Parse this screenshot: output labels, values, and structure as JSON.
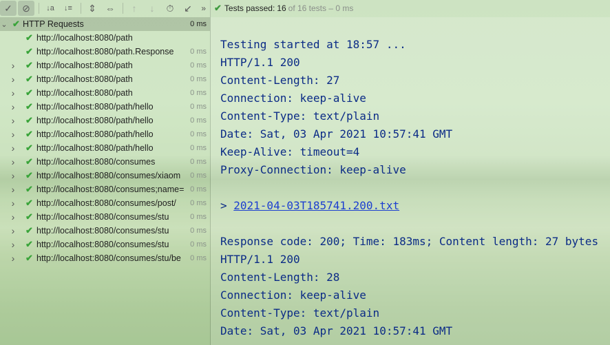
{
  "toolbar": {
    "buttons": [
      {
        "name": "show-passed-icon",
        "glyph": "✓"
      },
      {
        "name": "show-ignored-icon",
        "glyph": "⊘"
      },
      {
        "name": "sort-alphabetically-icon",
        "glyph": "↓a"
      },
      {
        "name": "sort-by-duration-icon",
        "glyph": "↓≡"
      },
      {
        "name": "expand-all-icon",
        "glyph": "⇕"
      },
      {
        "name": "collapse-all-icon",
        "glyph": "⇔"
      },
      {
        "name": "previous-failed-icon",
        "glyph": "↑"
      },
      {
        "name": "next-failed-icon",
        "glyph": "↓"
      },
      {
        "name": "test-history-icon",
        "glyph": "⏱"
      },
      {
        "name": "export-results-icon",
        "glyph": "↙"
      }
    ],
    "more_glyph": "»"
  },
  "status": {
    "passed_label": "Tests passed:",
    "count": "16",
    "rest": "of 16 tests – 0 ms"
  },
  "tree": {
    "root": {
      "label": "HTTP Requests",
      "time": "0 ms"
    },
    "items": [
      {
        "label": "http://localhost:8080/path",
        "time": "",
        "expandable": false
      },
      {
        "label": "http://localhost:8080/path.Response",
        "time": "0 ms",
        "expandable": false
      },
      {
        "label": "http://localhost:8080/path",
        "time": "0 ms",
        "expandable": true
      },
      {
        "label": "http://localhost:8080/path",
        "time": "0 ms",
        "expandable": true
      },
      {
        "label": "http://localhost:8080/path",
        "time": "0 ms",
        "expandable": true
      },
      {
        "label": "http://localhost:8080/path/hello",
        "time": "0 ms",
        "expandable": true
      },
      {
        "label": "http://localhost:8080/path/hello",
        "time": "0 ms",
        "expandable": true
      },
      {
        "label": "http://localhost:8080/path/hello",
        "time": "0 ms",
        "expandable": true
      },
      {
        "label": "http://localhost:8080/path/hello",
        "time": "0 ms",
        "expandable": true
      },
      {
        "label": "http://localhost:8080/consumes",
        "time": "0 ms",
        "expandable": true
      },
      {
        "label": "http://localhost:8080/consumes/xiaom",
        "time": "0 ms",
        "expandable": true
      },
      {
        "label": "http://localhost:8080/consumes;name=",
        "time": "0 ms",
        "expandable": true
      },
      {
        "label": "http://localhost:8080/consumes/post/",
        "time": "0 ms",
        "expandable": true
      },
      {
        "label": "http://localhost:8080/consumes/stu",
        "time": "0 ms",
        "expandable": true
      },
      {
        "label": "http://localhost:8080/consumes/stu",
        "time": "0 ms",
        "expandable": true
      },
      {
        "label": "http://localhost:8080/consumes/stu",
        "time": "0 ms",
        "expandable": true
      },
      {
        "label": "http://localhost:8080/consumes/stu/be",
        "time": "0 ms",
        "expandable": true
      }
    ]
  },
  "console": {
    "lines": [
      {
        "text": "Testing started at 18:57 ...",
        "link": false
      },
      {
        "text": "HTTP/1.1 200",
        "link": false
      },
      {
        "text": "Content-Length: 27",
        "link": false
      },
      {
        "text": "Connection: keep-alive",
        "link": false
      },
      {
        "text": "Content-Type: text/plain",
        "link": false
      },
      {
        "text": "Date: Sat, 03 Apr 2021 10:57:41 GMT",
        "link": false
      },
      {
        "text": "Keep-Alive: timeout=4",
        "link": false
      },
      {
        "text": "Proxy-Connection: keep-alive",
        "link": false
      },
      {
        "text": "",
        "link": false
      },
      {
        "text": "> ",
        "link": true,
        "link_text": "2021-04-03T185741.200.txt"
      },
      {
        "text": "",
        "link": false
      },
      {
        "text": "Response code: 200; Time: 183ms; Content length: 27 bytes",
        "link": false
      },
      {
        "text": "HTTP/1.1 200",
        "link": false
      },
      {
        "text": "Content-Length: 28",
        "link": false
      },
      {
        "text": "Connection: keep-alive",
        "link": false
      },
      {
        "text": "Content-Type: text/plain",
        "link": false
      },
      {
        "text": "Date: Sat, 03 Apr 2021 10:57:41 GMT",
        "link": false
      }
    ]
  }
}
